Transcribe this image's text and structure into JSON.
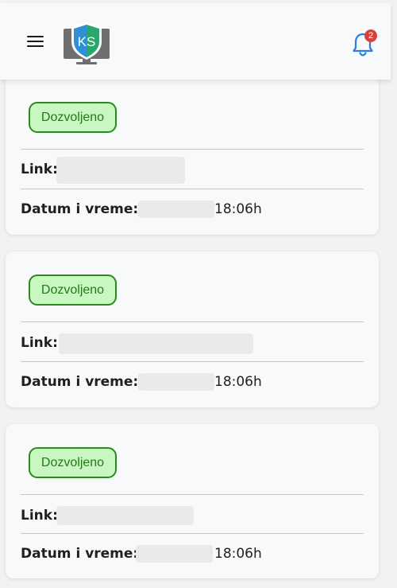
{
  "header": {
    "menu_icon": "hamburger-menu-icon",
    "logo_text": "KS",
    "logo_colors": {
      "shield_left": "#2f8fd6",
      "shield_right": "#2aa76a",
      "monitor": "#6f6f70"
    },
    "bell_icon": "bell-icon",
    "bell_color": "#2a7de1",
    "notification_count": "2",
    "badge_color": "#d9413b"
  },
  "entries": [
    {
      "status": "Dozvoljeno",
      "link_label": "Link:",
      "datetime_label": "Datum i vreme:",
      "time": "18:06h"
    },
    {
      "status": "Dozvoljeno",
      "link_label": "Link:",
      "datetime_label": "Datum i vreme:",
      "time": "18:06h"
    },
    {
      "status": "Dozvoljeno",
      "link_label": "Link:",
      "datetime_label": "Datum i vreme:",
      "time": "18:06h"
    }
  ],
  "status_colors": {
    "border": "#2c8a1f",
    "background": "#c9f7c1",
    "text": "#217a17"
  }
}
